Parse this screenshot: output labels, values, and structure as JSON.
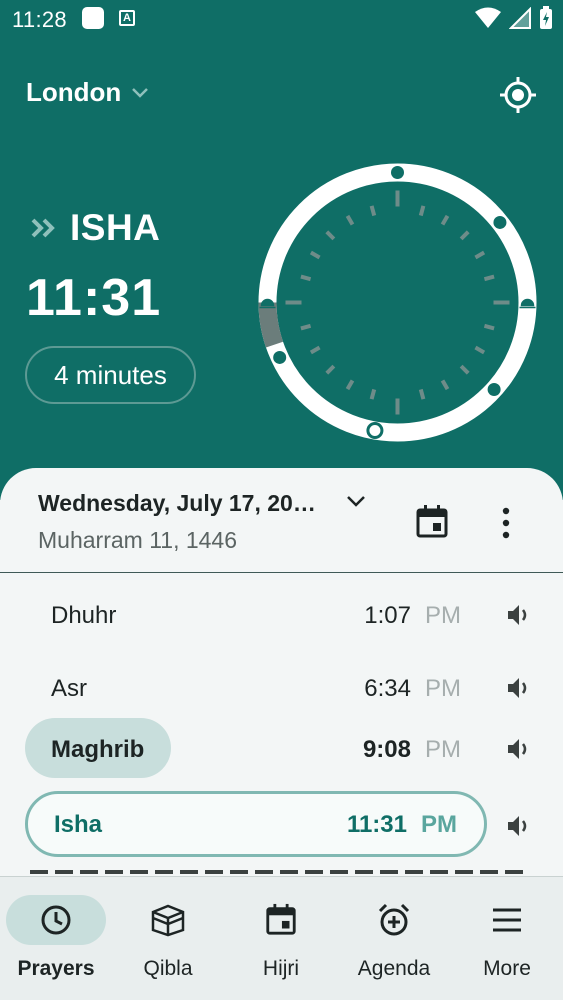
{
  "status": {
    "time": "11:28",
    "notif_letter": "A",
    "icons": [
      "wifi-icon",
      "signal-icon",
      "battery-charging-icon"
    ]
  },
  "header": {
    "city": "London",
    "city_icon": "chevron-down-icon",
    "locate_icon": "gps-locate-icon"
  },
  "current": {
    "prayer": "ISHA",
    "time": "11:31",
    "remaining": "4 minutes"
  },
  "colors": {
    "primary": "#0f6e66",
    "pill": "#c8dedc",
    "surface": "#f3f6f6",
    "outline": "#80b8b2"
  },
  "date": {
    "gregorian": "Wednesday, July 17, 20…",
    "hijri": "Muharram 11, 1446",
    "calendar_icon": "calendar-icon",
    "menu_icon": "more-vert-icon"
  },
  "prayers": [
    {
      "name": "Dhuhr",
      "time": "1:07",
      "ampm": "PM"
    },
    {
      "name": "Asr",
      "time": "6:34",
      "ampm": "PM"
    },
    {
      "name": "Maghrib",
      "time": "9:08",
      "ampm": "PM"
    },
    {
      "name": "Isha",
      "time": "11:31",
      "ampm": "PM"
    }
  ],
  "nav": [
    {
      "label": "Prayers",
      "icon": "clock-icon"
    },
    {
      "label": "Qibla",
      "icon": "kaaba-icon"
    },
    {
      "label": "Hijri",
      "icon": "calendar-icon"
    },
    {
      "label": "Agenda",
      "icon": "alarm-icon"
    },
    {
      "label": "More",
      "icon": "menu-icon"
    }
  ]
}
